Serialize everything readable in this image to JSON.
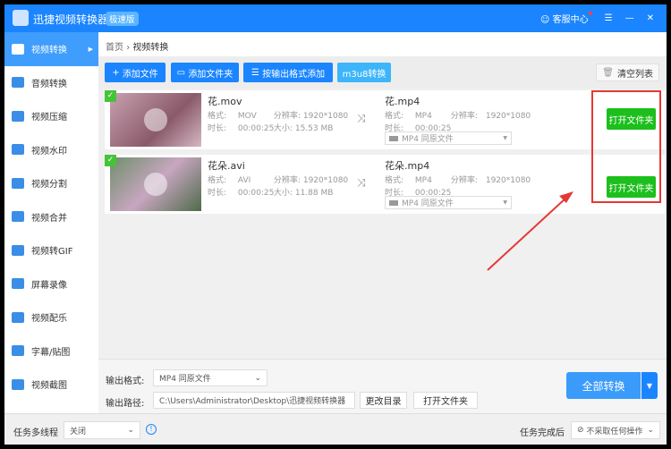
{
  "app": {
    "title": "迅捷视频转换器",
    "edition": "极速版",
    "support": "客服中心"
  },
  "sidebar": {
    "items": [
      {
        "label": "视频转换"
      },
      {
        "label": "音频转换"
      },
      {
        "label": "视频压缩"
      },
      {
        "label": "视频水印"
      },
      {
        "label": "视频分割"
      },
      {
        "label": "视频合并"
      },
      {
        "label": "视频转GIF"
      },
      {
        "label": "屏幕录像"
      },
      {
        "label": "视频配乐"
      },
      {
        "label": "字幕/贴图"
      },
      {
        "label": "视频截图"
      }
    ]
  },
  "breadcrumb": {
    "home": "首页",
    "sep": "›",
    "current": "视频转换"
  },
  "toolbar": {
    "add_file": "添加文件",
    "add_folder": "添加文件夹",
    "add_by_format": "按输出格式添加",
    "m3u8": "m3u8转换",
    "clear": "清空列表"
  },
  "labels": {
    "format": "格式:",
    "resolution": "分辨率:",
    "duration": "时长:",
    "size": "大小:",
    "open_folder": "打开文件夹"
  },
  "files": [
    {
      "name": "花.mov",
      "format": "MOV",
      "resolution": "1920*1080",
      "duration": "00:00:25",
      "size": "15.53 MB",
      "out_name": "花.mp4",
      "out_format": "MP4",
      "out_resolution": "1920*1080",
      "out_duration": "00:00:25",
      "out_select": "MP4  同原文件"
    },
    {
      "name": "花朵.avi",
      "format": "AVI",
      "resolution": "1920*1080",
      "duration": "00:00:25",
      "size": "11.88 MB",
      "out_name": "花朵.mp4",
      "out_format": "MP4",
      "out_resolution": "1920*1080",
      "out_duration": "00:00:25",
      "out_select": "MP4  同原文件"
    }
  ],
  "bottom": {
    "format_label": "输出格式:",
    "format_value": "MP4  同原文件",
    "path_label": "输出路径:",
    "path_value": "C:\\Users\\Administrator\\Desktop\\迅捷视频转换器",
    "change_dir": "更改目录",
    "open_folder": "打开文件夹",
    "convert_all": "全部转换"
  },
  "status": {
    "multithread_label": "任务多线程",
    "multithread_value": "关闭",
    "after_label": "任务完成后",
    "after_value": "不采取任何操作"
  }
}
